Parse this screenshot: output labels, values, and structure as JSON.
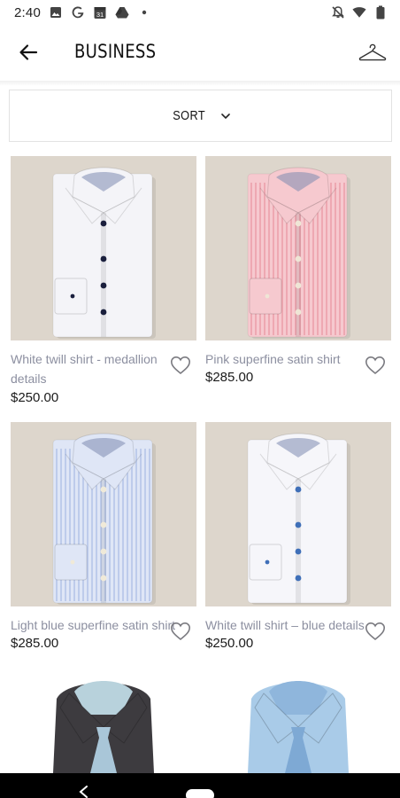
{
  "status_bar": {
    "time": "2:40",
    "left_icons": [
      "image-icon",
      "google-g-icon",
      "calendar-31-icon",
      "drive-icon",
      "dot-icon"
    ],
    "calendar_day": "31",
    "right_icons": [
      "bell-off-icon",
      "wifi-icon",
      "battery-icon"
    ]
  },
  "app_bar": {
    "title": "BUSINESS",
    "back_icon": "arrow-left-icon",
    "action_icon": "hanger-icon"
  },
  "sort": {
    "label": "SORT",
    "icon": "chevron-down-icon"
  },
  "products": [
    {
      "name": "White twill shirt - medallion details",
      "price": "$250.00",
      "shirt_color": "#f4f4f8",
      "stripe_color": "#f4f4f8",
      "button_color": "#1a1f3d"
    },
    {
      "name": "Pink superfine satin shirt",
      "price": "$285.00",
      "shirt_color": "#f6c9cf",
      "stripe_color": "#e88a97",
      "button_color": "#efe6d6"
    },
    {
      "name": "Light blue superfine satin shirt",
      "price": "$285.00",
      "shirt_color": "#dfe6f6",
      "stripe_color": "#9fb3e2",
      "button_color": "#f0ead8"
    },
    {
      "name": "White twill shirt – blue details",
      "price": "$250.00",
      "shirt_color": "#f6f6fa",
      "stripe_color": "#f6f6fa",
      "button_color": "#3f6fb8"
    }
  ],
  "partial_products": [
    {
      "shirt_color": "#3d3b3f",
      "collar_inner": "#b8d2dc",
      "tie_color": "#a9c6d8"
    },
    {
      "shirt_color": "#a9cbe8",
      "collar_inner": "#8fb6dc",
      "tie_color": "#7ea9d4"
    }
  ],
  "colors": {
    "photo_background": "#ddd6cc",
    "product_name": "#8c8fa0",
    "price": "#1a1a1a"
  }
}
